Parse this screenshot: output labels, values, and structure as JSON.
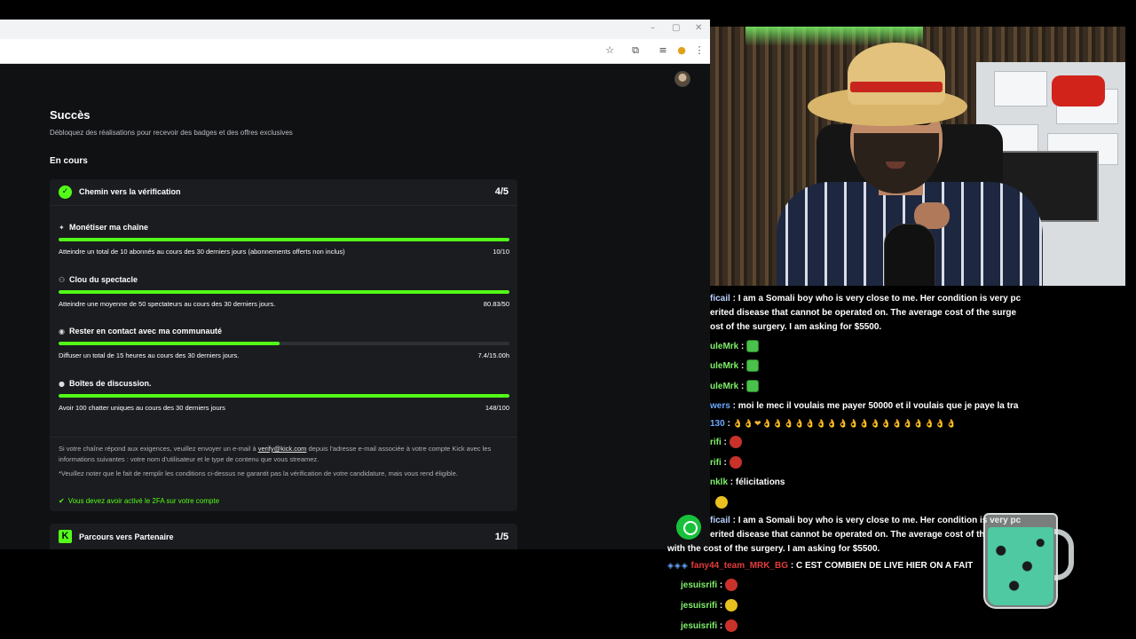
{
  "page": {
    "title": "Succès",
    "subtitle": "Débloquez des réalisations pour recevoir des badges et des offres exclusives",
    "section": "En cours"
  },
  "card": {
    "title": "Chemin vers la vérification",
    "count": "4/5",
    "tasks": [
      {
        "title": "Monétiser ma chaîne",
        "desc": "Atteindre un total de 10 abonnés au cours des 30 derniers jours (abonnements offerts non inclus)",
        "value": "10/10",
        "progress": 1.0
      },
      {
        "title": "Clou du spectacle",
        "desc": "Atteindre une moyenne de 50 spectateurs au cours des 30 derniers jours.",
        "value": "80.83/50",
        "progress": 1.0
      },
      {
        "title": "Rester en contact avec ma communauté",
        "desc": "Diffuser un total de 15 heures au cours des 30 derniers jours.",
        "value": "7.4/15.00h",
        "progress": 0.49
      },
      {
        "title": "Boîtes de discussion.",
        "desc": "Avoir 100 chatter uniques au cours des 30 derniers jours",
        "value": "148/100",
        "progress": 1.0
      }
    ],
    "note1_a": "Si votre chaîne répond aux exigences, veuillez envoyer un e-mail à ",
    "note1_link": "verify@kick.com",
    "note1_b": " depuis l'adresse e-mail associée à votre compte Kick avec les informations suivantes : votre nom d'utilisateur et le type de contenu que vous streamez.",
    "note2": "*Veuillez noter que le fait de remplir les conditions ci-dessus ne garantit pas la vérification de votre candidature, mais vous rend éligible.",
    "check": "Vous devez avoir activé le 2FA sur votre compte"
  },
  "card2": {
    "logo": "K",
    "title": "Parcours vers Partenaire",
    "count": "1/5"
  },
  "chat": {
    "messages": [
      {
        "nick": "ficail",
        "nick_color": "#b9d0ff",
        "text": "I am a Somali boy who is very close to me. Her condition is very pc"
      },
      {
        "nick": "",
        "nick_color": "#ffffff",
        "text": "erited disease that cannot be operated on. The average cost of the surge"
      },
      {
        "nick": "",
        "nick_color": "#ffffff",
        "text": "ost of the surgery. I am asking for $5500."
      },
      {
        "nick": "uleMrk",
        "nick_color": "#7ff06a",
        "text": ""
      },
      {
        "nick": "uleMrk",
        "nick_color": "#7ff06a",
        "text": ""
      },
      {
        "nick": "uleMrk",
        "nick_color": "#7ff06a",
        "text": ""
      },
      {
        "nick": "wers",
        "nick_color": "#6aa8ff",
        "text": "moi le mec il voulais me payer 50000 et il voulais que je paye la tra"
      },
      {
        "nick": "130",
        "nick_color": "#6aa8ff",
        "text": ""
      },
      {
        "nick": "rifi",
        "nick_color": "#7ff06a",
        "text": ""
      },
      {
        "nick": "rifi",
        "nick_color": "#7ff06a",
        "text": ""
      },
      {
        "nick": "nklk",
        "nick_color": "#7ff06a",
        "text": "félicitations"
      },
      {
        "nick": "ficail",
        "nick_color": "#b9d0ff",
        "text": "I am a Somali boy who is very close to me. Her condition is very pc"
      },
      {
        "nick": "",
        "nick_color": "#ffffff",
        "text": "erited disease that cannot be operated on. The average cost of th"
      },
      {
        "nick": "",
        "nick_color": "#ffffff",
        "text": "with the cost of the surgery. I am asking for $5500."
      },
      {
        "nick": "fany44_team_MRK_BG",
        "nick_color": "#e23b3b",
        "text": "C EST COMBIEN DE LIVE HIER ON A FAIT"
      },
      {
        "nick": "jesuisrifi",
        "nick_color": "#7ff06a",
        "text": ""
      },
      {
        "nick": "jesuisrifi",
        "nick_color": "#7ff06a",
        "text": ""
      },
      {
        "nick": "jesuisrifi",
        "nick_color": "#7ff06a",
        "text": ""
      }
    ]
  },
  "icons": {
    "verified": "verified-badge-icon",
    "star": "bookmark-star-icon",
    "extensions": "extensions-icon",
    "menu": "kebab-menu-icon"
  },
  "colors": {
    "accent": "#53fc18",
    "card_bg": "#1a1c1f",
    "page_bg": "#101113"
  }
}
